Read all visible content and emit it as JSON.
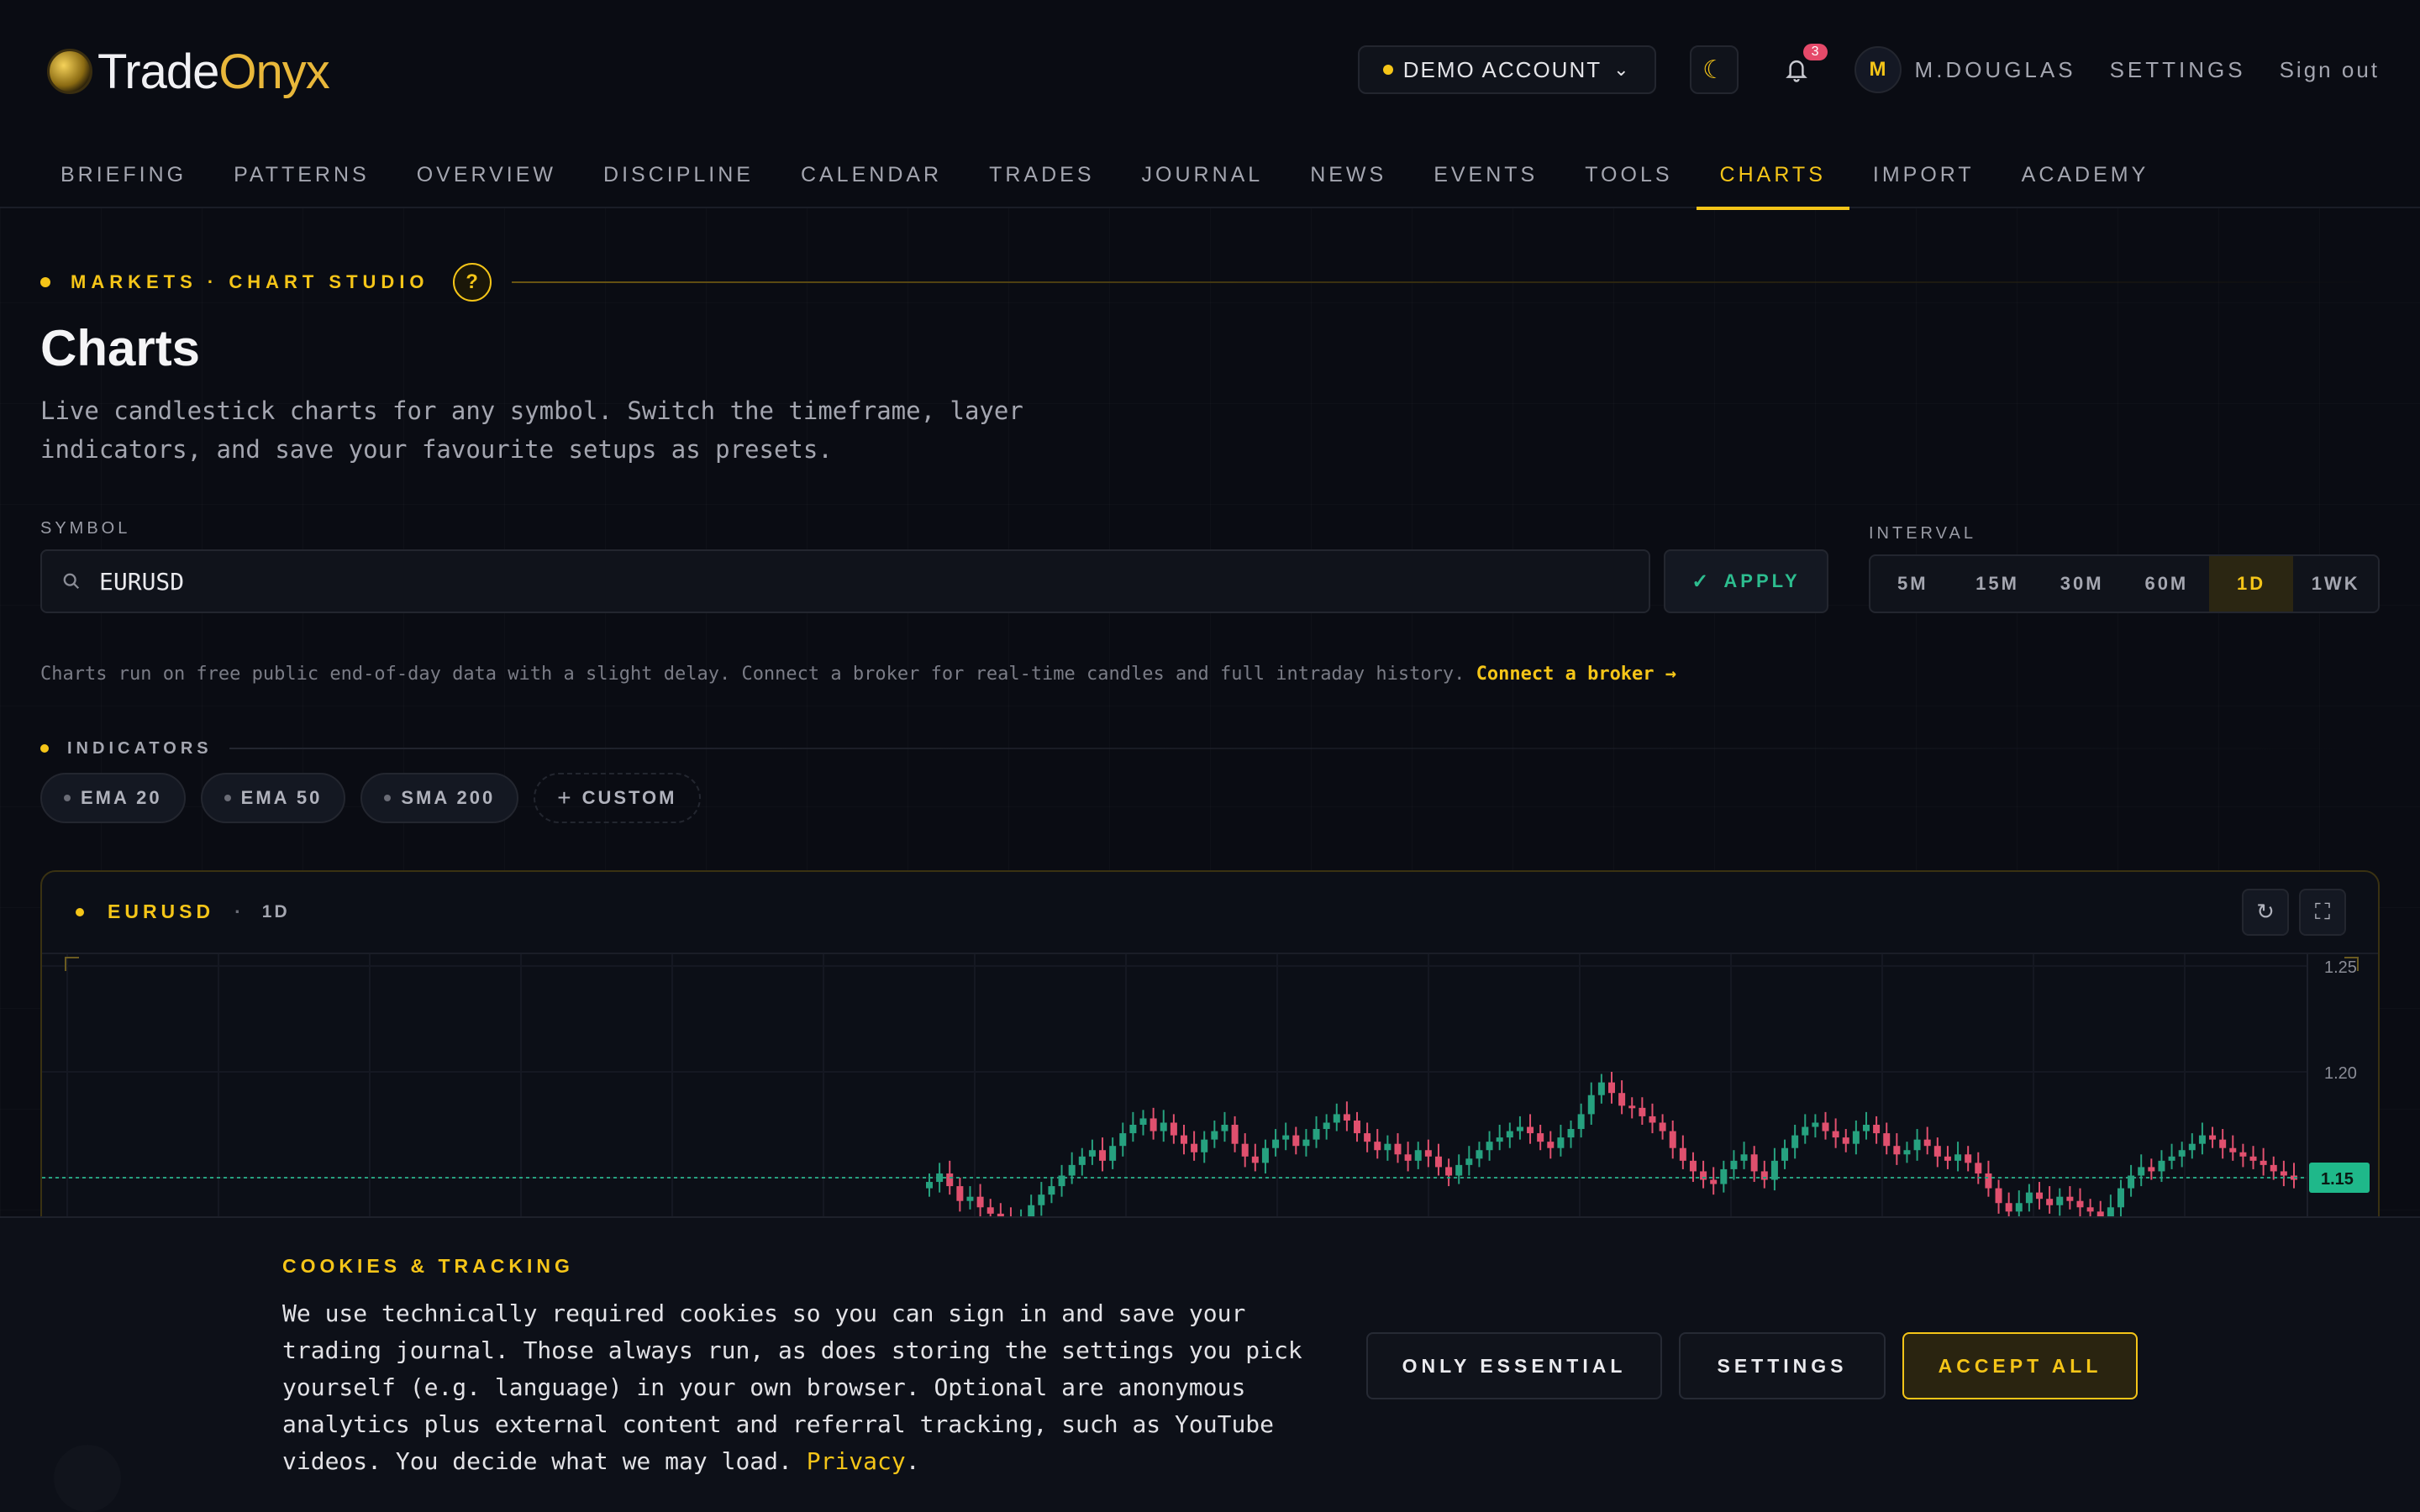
{
  "brand": {
    "name_a": "Trade",
    "name_b": "Onyx"
  },
  "header": {
    "account_label": "DEMO ACCOUNT",
    "notifications_count": "3",
    "avatar_initial": "M",
    "username": "M.DOUGLAS",
    "settings_label": "SETTINGS",
    "signout_label": "Sign out"
  },
  "nav": {
    "items": [
      "BRIEFING",
      "PATTERNS",
      "OVERVIEW",
      "DISCIPLINE",
      "CALENDAR",
      "TRADES",
      "JOURNAL",
      "NEWS",
      "EVENTS",
      "TOOLS",
      "CHARTS",
      "IMPORT",
      "ACADEMY"
    ],
    "active": "CHARTS"
  },
  "section": {
    "eyebrow": "MARKETS · CHART STUDIO",
    "help": "?",
    "title": "Charts",
    "subtitle": "Live candlestick charts for any symbol. Switch the timeframe, layer indicators, and save your favourite setups as presets."
  },
  "symbol": {
    "label": "SYMBOL",
    "value": "EURUSD",
    "apply_label": "APPLY"
  },
  "interval": {
    "label": "INTERVAL",
    "options": [
      "5M",
      "15M",
      "30M",
      "60M",
      "1D",
      "1WK"
    ],
    "selected": "1D"
  },
  "note": {
    "text": "Charts run on free public end-of-day data with a slight delay. Connect a broker for real-time candles and full intraday history.",
    "link": "Connect a broker →"
  },
  "indicators": {
    "label": "INDICATORS",
    "chips": [
      "EMA 20",
      "EMA 50",
      "SMA 200"
    ],
    "custom_label": "CUSTOM"
  },
  "chart_card": {
    "symbol": "EURUSD",
    "interval": "1D"
  },
  "chart_data": {
    "type": "candlestick",
    "y_ticks": [
      "1.25",
      "1.20",
      "1.15"
    ],
    "ylim": [
      1.0,
      1.25
    ],
    "last_price": "1.15",
    "up_color": "#26a17f",
    "down_color": "#e0506e",
    "closes": [
      1.148,
      1.152,
      1.146,
      1.139,
      1.141,
      1.136,
      1.133,
      1.13,
      1.128,
      1.131,
      1.137,
      1.142,
      1.146,
      1.151,
      1.156,
      1.16,
      1.163,
      1.158,
      1.165,
      1.171,
      1.175,
      1.178,
      1.172,
      1.176,
      1.17,
      1.166,
      1.162,
      1.168,
      1.172,
      1.175,
      1.166,
      1.16,
      1.157,
      1.164,
      1.168,
      1.17,
      1.165,
      1.168,
      1.173,
      1.176,
      1.18,
      1.177,
      1.171,
      1.167,
      1.163,
      1.166,
      1.161,
      1.158,
      1.163,
      1.16,
      1.155,
      1.151,
      1.156,
      1.159,
      1.163,
      1.167,
      1.169,
      1.172,
      1.174,
      1.171,
      1.167,
      1.164,
      1.169,
      1.173,
      1.18,
      1.189,
      1.195,
      1.19,
      1.184,
      1.183,
      1.179,
      1.176,
      1.172,
      1.164,
      1.158,
      1.153,
      1.149,
      1.147,
      1.154,
      1.158,
      1.161,
      1.153,
      1.149,
      1.158,
      1.164,
      1.17,
      1.174,
      1.176,
      1.172,
      1.169,
      1.166,
      1.172,
      1.175,
      1.171,
      1.165,
      1.161,
      1.163,
      1.168,
      1.165,
      1.16,
      1.158,
      1.161,
      1.157,
      1.152,
      1.145,
      1.138,
      1.134,
      1.138,
      1.143,
      1.14,
      1.137,
      1.141,
      1.139,
      1.136,
      1.134,
      1.131,
      1.136,
      1.145,
      1.151,
      1.155,
      1.153,
      1.158,
      1.16,
      1.163,
      1.166,
      1.17,
      1.168,
      1.164,
      1.162,
      1.16,
      1.158,
      1.156,
      1.153,
      1.151,
      1.149
    ]
  },
  "cookie": {
    "title": "COOKIES & TRACKING",
    "text": "We use technically required cookies so you can sign in and save your trading journal. Those always run, as does storing the settings you pick yourself (e.g. language) in your own browser. Optional are anonymous analytics plus external content and referral tracking, such as YouTube videos. You decide what we may load.",
    "link": "Privacy",
    "link_suffix": ".",
    "essential_label": "ONLY ESSENTIAL",
    "settings_label": "SETTINGS",
    "accept_label": "ACCEPT ALL"
  }
}
